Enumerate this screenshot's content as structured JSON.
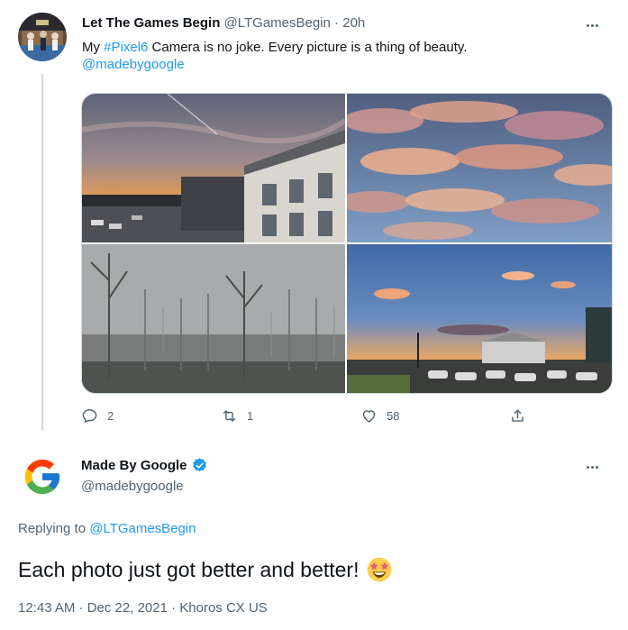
{
  "tweet1": {
    "author_name": "Let The Games Begin",
    "handle": "@LTGamesBegin",
    "separator": " · ",
    "time": "20h",
    "text_before": "My ",
    "hashtag": "#Pixel6",
    "text_after": " Camera is no joke. Every picture is a thing of beauty.",
    "mention": "@madebygoogle",
    "replies": "2",
    "retweets": "1",
    "likes": "58"
  },
  "tweet2": {
    "author_name": "Made By Google",
    "handle": "@madebygoogle",
    "replying_prefix": "Replying to ",
    "replying_handle": "@LTGamesBegin",
    "text": "Each photo just got better and better!",
    "emoji": "star-struck-emoji",
    "timestamp": "12:43 AM · Dec 22, 2021 · Khoros CX US"
  },
  "icons": {
    "reply": "comment-bubble-icon",
    "retweet": "retweet-icon",
    "like": "heart-icon",
    "share": "share-icon",
    "more": "more-dots-icon",
    "verified": "verified-badge-icon"
  },
  "colors": {
    "accent": "#1d9bf0",
    "text": "#0f1419",
    "secondary": "#536471",
    "border": "#cfd9de"
  }
}
